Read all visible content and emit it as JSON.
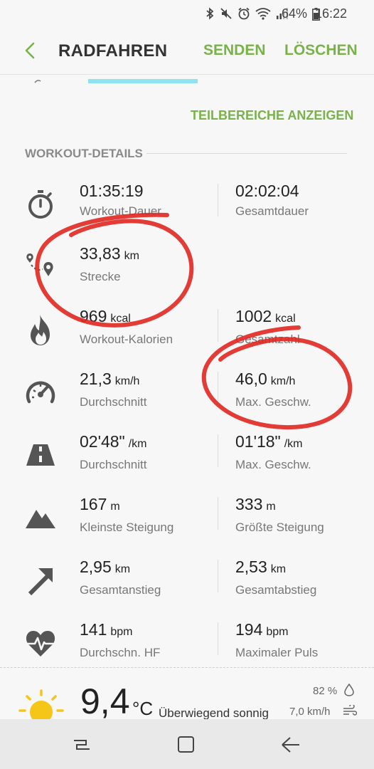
{
  "status_bar": {
    "battery_percent": "64%",
    "time": "16:22",
    "icons": [
      "bluetooth-icon",
      "mute-icon",
      "alarm-icon",
      "wifi-icon",
      "signal-icon",
      "battery-icon"
    ]
  },
  "app_bar": {
    "title": "RADFAHREN",
    "send_label": "SENDEN",
    "delete_label": "LÖSCHEN"
  },
  "accent_color": "#7ab24a",
  "show_sections_label": "TEILBEREICHE ANZEIGEN",
  "section_title": "WORKOUT-DETAILS",
  "rows": [
    {
      "icon": "stopwatch-icon",
      "left": {
        "value": "01:35:19",
        "unit": "",
        "label": "Workout-Dauer"
      },
      "right": {
        "value": "02:02:04",
        "unit": "",
        "label": "Gesamtdauer"
      }
    },
    {
      "icon": "route-icon",
      "left": {
        "value": "33,83",
        "unit": "km",
        "label": "Strecke"
      },
      "right": null
    },
    {
      "icon": "flame-icon",
      "left": {
        "value": "969",
        "unit": "kcal",
        "label": "Workout-Kalorien"
      },
      "right": {
        "value": "1002",
        "unit": "kcal",
        "label": "Gesamtzahl"
      }
    },
    {
      "icon": "speedometer-icon",
      "left": {
        "value": "21,3",
        "unit": "km/h",
        "label": "Durchschnitt"
      },
      "right": {
        "value": "46,0",
        "unit": "km/h",
        "label": "Max. Geschw."
      }
    },
    {
      "icon": "road-icon",
      "left": {
        "value": "02'48\"",
        "unit": "/km",
        "label": "Durchschnitt"
      },
      "right": {
        "value": "01'18\"",
        "unit": "/km",
        "label": "Max. Geschw."
      }
    },
    {
      "icon": "mountain-icon",
      "left": {
        "value": "167",
        "unit": "m",
        "label": "Kleinste Steigung"
      },
      "right": {
        "value": "333",
        "unit": "m",
        "label": "Größte Steigung"
      }
    },
    {
      "icon": "arrow-up-right-icon",
      "left": {
        "value": "2,95",
        "unit": "km",
        "label": "Gesamtanstieg"
      },
      "right": {
        "value": "2,53",
        "unit": "km",
        "label": "Gesamtabstieg"
      }
    },
    {
      "icon": "heart-rate-icon",
      "left": {
        "value": "141",
        "unit": "bpm",
        "label": "Durchschn. HF"
      },
      "right": {
        "value": "194",
        "unit": "bpm",
        "label": "Maximaler Puls"
      }
    }
  ],
  "weather": {
    "temperature": "9,4",
    "temperature_unit": "°C",
    "description": "Überwiegend sonnig",
    "humidity": "82 %",
    "wind": "7,0 km/h",
    "icon": "sun-icon"
  },
  "annotation_color": "#e0261f"
}
